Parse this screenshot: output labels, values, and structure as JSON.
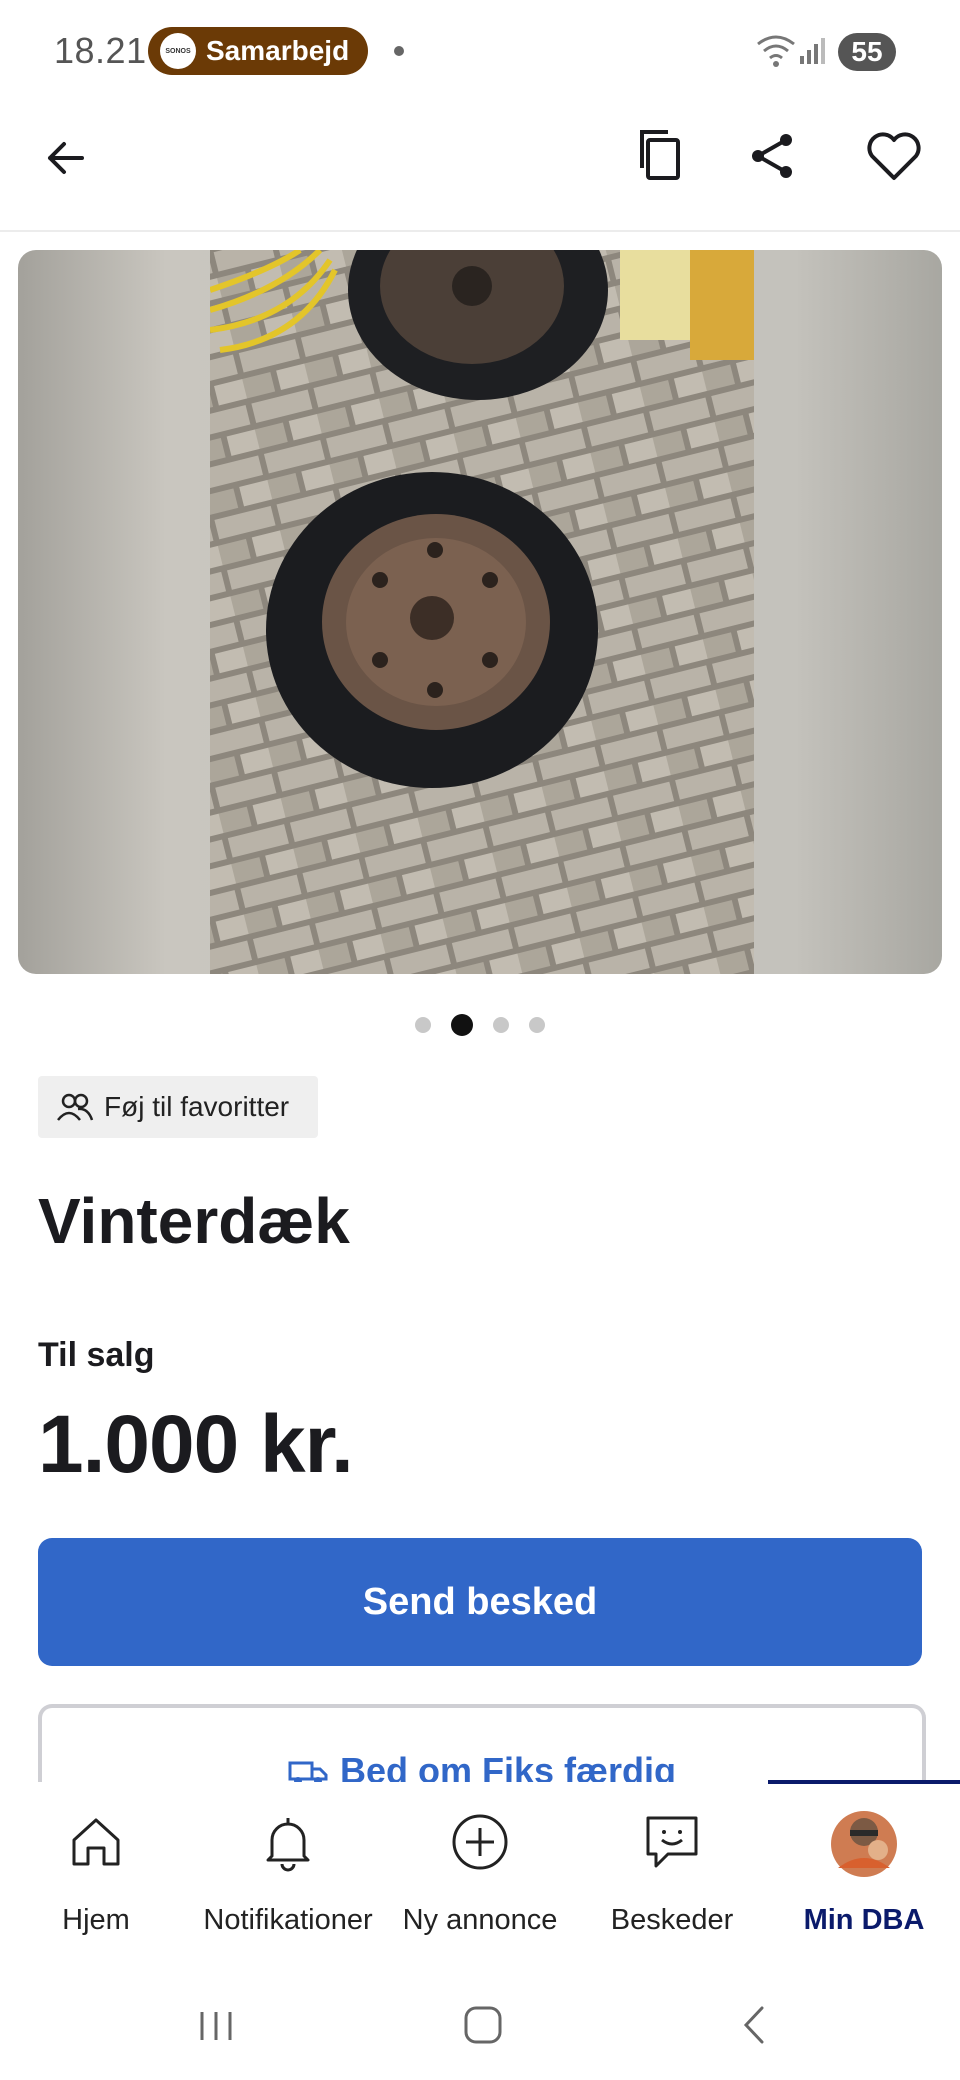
{
  "status_bar": {
    "time": "18.21",
    "notification_label": "Samarbejd",
    "battery": "55"
  },
  "listing": {
    "favorite_chip_label": "Føj til favoritter",
    "title": "Vinterdæk",
    "type": "Til salg",
    "price": "1.000 kr.",
    "image_count": 4,
    "active_image": 2
  },
  "actions": {
    "send_message": "Send besked",
    "fiks_label": "Bed om Fiks færdig"
  },
  "bottom_nav": {
    "items": [
      {
        "label": "Hjem",
        "icon": "home-icon"
      },
      {
        "label": "Notifikationer",
        "icon": "bell-icon"
      },
      {
        "label": "Ny annonce",
        "icon": "plus-circle-icon"
      },
      {
        "label": "Beskeder",
        "icon": "chat-icon"
      },
      {
        "label": "Min DBA",
        "icon": "avatar"
      }
    ],
    "selected": "Min DBA"
  },
  "colors": {
    "primary": "#3167c8",
    "nav_selected": "#0a1a6b",
    "notification_pill": "#6b3a06"
  }
}
